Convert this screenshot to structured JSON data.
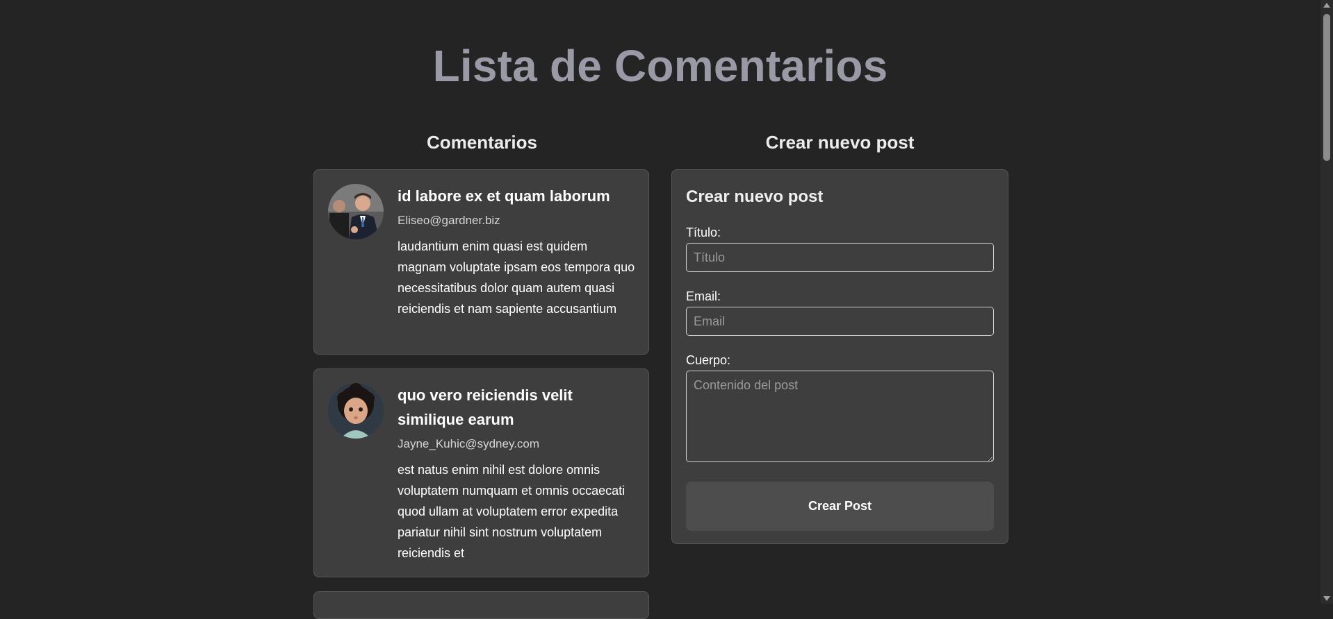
{
  "page": {
    "title": "Lista de Comentarios"
  },
  "comments_section": {
    "heading": "Comentarios",
    "items": [
      {
        "title": "id labore ex et quam laborum",
        "email": "Eliseo@gardner.biz",
        "body": "laudantium enim quasi est quidem magnam voluptate ipsam eos tempora quo necessitatibus dolor quam autem quasi reiciendis et nam sapiente accusantium",
        "avatar_icon": "avatar-photo-two-men-in-suits"
      },
      {
        "title": "quo vero reiciendis velit similique earum",
        "email": "Jayne_Kuhic@sydney.com",
        "body": "est natus enim nihil est dolore omnis voluptatem numquam et omnis occaecati quod ullam at voluptatem error expedita pariatur nihil sint nostrum voluptatem reiciendis et",
        "avatar_icon": "avatar-photo-child"
      }
    ]
  },
  "form_section": {
    "heading": "Crear nuevo post",
    "card_title": "Crear nuevo post",
    "fields": {
      "titulo": {
        "label": "Título:",
        "placeholder": "Título",
        "value": ""
      },
      "email": {
        "label": "Email:",
        "placeholder": "Email",
        "value": ""
      },
      "cuerpo": {
        "label": "Cuerpo:",
        "placeholder": "Contenido del post",
        "value": ""
      }
    },
    "submit_label": "Crear Post"
  },
  "colors": {
    "background": "#242424",
    "card": "#3e3e3e",
    "title": "#9a9aa6",
    "button": "#4d4d4d"
  }
}
